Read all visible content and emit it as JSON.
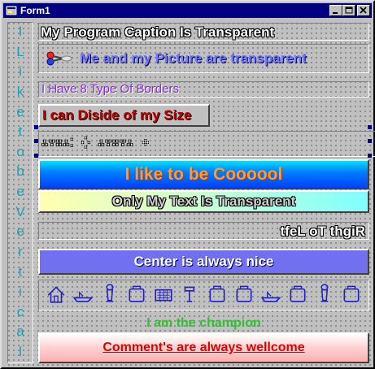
{
  "window": {
    "title": "Form1",
    "controls": {
      "minimize": "_",
      "maximize": "□",
      "close": "×"
    }
  },
  "vertical_label": [
    "I",
    "L",
    "i",
    "k",
    "e",
    "t",
    "o",
    "b",
    "e",
    "V",
    "e",
    "r",
    "t",
    "i",
    "c",
    "a",
    "l"
  ],
  "labels": {
    "caption_transparent": "My Program Caption Is Transparent",
    "picture_transparent": "Me and my Picture are transparent",
    "borders": "I Have 8 Type Of Borders",
    "size": "I can Diside of my Size",
    "symbols": "∴∵∷∴⁚ ⁛ ∴∵∷∵∴ ⁘",
    "cool": "I like to be Coooool",
    "text_transparent": "Only My Text Is Transparent",
    "right_to_left": "tfeL oT thgiR",
    "center": "Center is always nice",
    "champion": "I am the champion",
    "comments": "Comment's are always wellcome"
  },
  "icons": [
    "house-icon",
    "boat-icon",
    "figure-icon",
    "box-icon",
    "basket-icon",
    "hammer-icon",
    "box-icon",
    "box-icon",
    "boat-icon",
    "box-icon",
    "figure-icon",
    "box-icon"
  ],
  "colors": {
    "title_bar": "#000080",
    "vertical_text": "#20a0b0",
    "picture_text": "#6f78ff",
    "borders_text": "#8a2be2",
    "size_text": "#c00000",
    "cool_text": "#ff9a3c",
    "center_bg": "#7070f0",
    "champion_text": "#30c030",
    "comment_text": "#e00000"
  }
}
